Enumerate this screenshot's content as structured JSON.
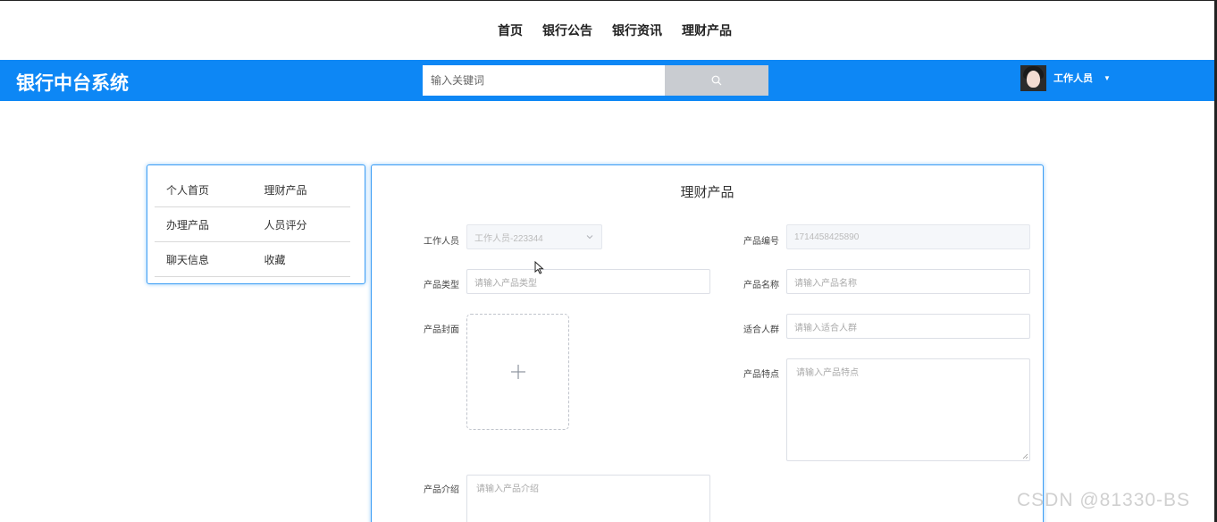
{
  "topnav": {
    "items": [
      {
        "label": "首页"
      },
      {
        "label": "银行公告"
      },
      {
        "label": "银行资讯"
      },
      {
        "label": "理财产品"
      }
    ]
  },
  "header": {
    "brand": "银行中台系统",
    "search_placeholder": "输入关键词",
    "search_icon": "search-icon",
    "user_name": "工作人员",
    "accent_color": "#0d87f5"
  },
  "side_menu": {
    "rows": [
      [
        "个人首页",
        "理财产品"
      ],
      [
        "办理产品",
        "人员评分"
      ],
      [
        "聊天信息",
        "收藏"
      ]
    ]
  },
  "form": {
    "title": "理财产品",
    "staff": {
      "label": "工作人员",
      "value": "工作人员-223344"
    },
    "product_no": {
      "label": "产品编号",
      "value": "1714458425890"
    },
    "product_type": {
      "label": "产品类型",
      "placeholder": "请输入产品类型"
    },
    "product_name": {
      "label": "产品名称",
      "placeholder": "请输入产品名称"
    },
    "cover": {
      "label": "产品封面"
    },
    "audience": {
      "label": "适合人群",
      "placeholder": "请输入适合人群"
    },
    "features": {
      "label": "产品特点",
      "placeholder": "请输入产品特点"
    },
    "intro": {
      "label": "产品介绍",
      "placeholder": "请输入产品介绍"
    }
  },
  "watermark": "CSDN @81330-BS"
}
